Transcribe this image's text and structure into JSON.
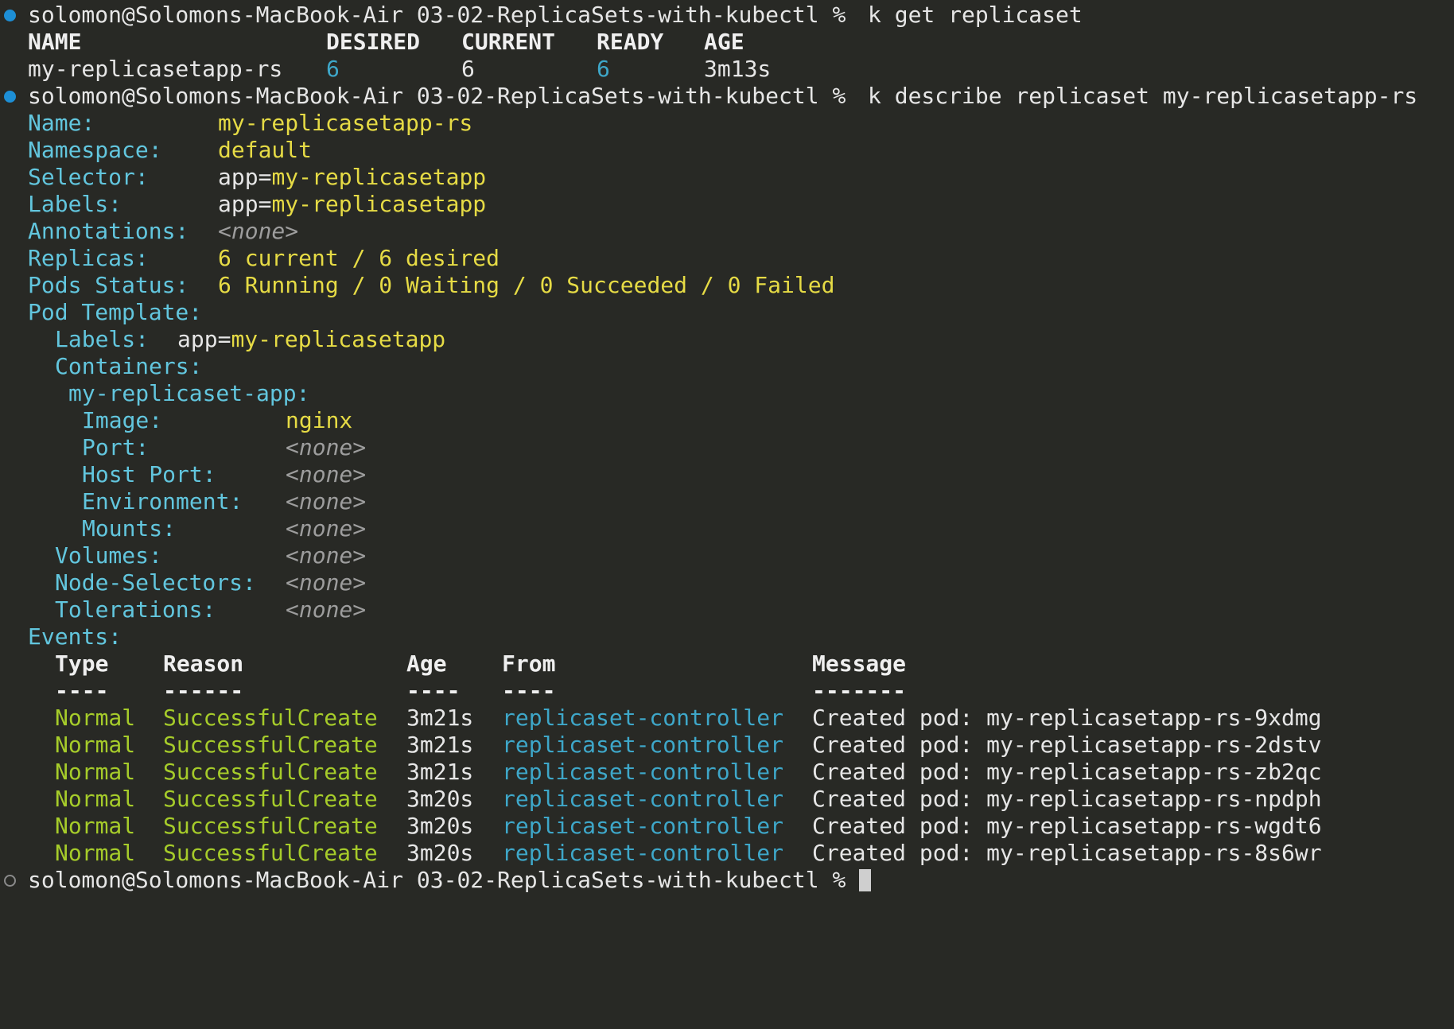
{
  "terminal": {
    "prompt": "solomon@Solomons-MacBook-Air 03-02-ReplicaSets-with-kubectl %",
    "cmd1": "k get replicaset",
    "cmd2": "k describe replicaset my-replicasetapp-rs",
    "get_table": {
      "headers": [
        "NAME",
        "DESIRED",
        "CURRENT",
        "READY",
        "AGE"
      ],
      "row": [
        "my-replicasetapp-rs",
        "6",
        "6",
        "6",
        "3m13s"
      ]
    },
    "describe": {
      "name_label": "Name:",
      "name_value": "my-replicasetapp-rs",
      "namespace_label": "Namespace:",
      "namespace_value": "default",
      "selector_label": "Selector:",
      "selector_key": "app=",
      "selector_value": "my-replicasetapp",
      "labels_label": "Labels:",
      "labels_key": "app=",
      "labels_value": "my-replicasetapp",
      "annotations_label": "Annotations:",
      "annotations_value": "<none>",
      "replicas_label": "Replicas:",
      "replicas_value": "6 current / 6 desired",
      "pods_status_label": "Pods Status:",
      "pods_status_value": "6 Running / 0 Waiting / 0 Succeeded / 0 Failed",
      "pod_template_label": "Pod Template:",
      "pt_labels_label": "Labels:",
      "pt_labels_key": "app=",
      "pt_labels_value": "my-replicasetapp",
      "containers_label": "Containers:",
      "container_name": "my-replicaset-app:",
      "image_label": "Image:",
      "image_value": "nginx",
      "port_label": "Port:",
      "port_value": "<none>",
      "host_port_label": "Host Port:",
      "host_port_value": "<none>",
      "environment_label": "Environment:",
      "environment_value": "<none>",
      "mounts_label": "Mounts:",
      "mounts_value": "<none>",
      "volumes_label": "Volumes:",
      "volumes_value": "<none>",
      "node_selectors_label": "Node-Selectors:",
      "node_selectors_value": "<none>",
      "tolerations_label": "Tolerations:",
      "tolerations_value": "<none>",
      "events_label": "Events:"
    },
    "events": {
      "headers": [
        "Type",
        "Reason",
        "Age",
        "From",
        "Message"
      ],
      "underlines": [
        "----",
        "------",
        "----",
        "----",
        "-------"
      ],
      "rows": [
        [
          "Normal",
          "SuccessfulCreate",
          "3m21s",
          "replicaset-controller",
          "Created pod: my-replicasetapp-rs-9xdmg"
        ],
        [
          "Normal",
          "SuccessfulCreate",
          "3m21s",
          "replicaset-controller",
          "Created pod: my-replicasetapp-rs-2dstv"
        ],
        [
          "Normal",
          "SuccessfulCreate",
          "3m21s",
          "replicaset-controller",
          "Created pod: my-replicasetapp-rs-zb2qc"
        ],
        [
          "Normal",
          "SuccessfulCreate",
          "3m20s",
          "replicaset-controller",
          "Created pod: my-replicasetapp-rs-npdph"
        ],
        [
          "Normal",
          "SuccessfulCreate",
          "3m20s",
          "replicaset-controller",
          "Created pod: my-replicasetapp-rs-wgdt6"
        ],
        [
          "Normal",
          "SuccessfulCreate",
          "3m20s",
          "replicaset-controller",
          "Created pod: my-replicasetapp-rs-8s6wr"
        ]
      ]
    }
  }
}
